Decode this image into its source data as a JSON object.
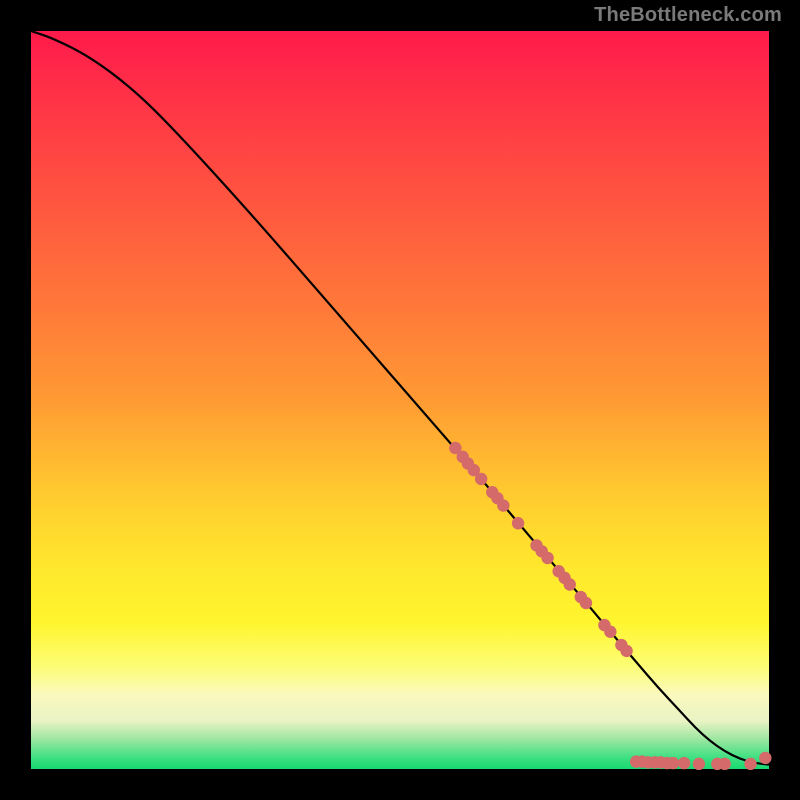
{
  "watermark": "TheBottleneck.com",
  "colors": {
    "bg": "#000000",
    "line": "#000000",
    "dot": "#d46a6a",
    "gradient_stops": [
      {
        "offset": 0.0,
        "color": "#ff1a4b"
      },
      {
        "offset": 0.12,
        "color": "#ff3a45"
      },
      {
        "offset": 0.25,
        "color": "#ff5a3f"
      },
      {
        "offset": 0.38,
        "color": "#ff7a39"
      },
      {
        "offset": 0.5,
        "color": "#ff9a33"
      },
      {
        "offset": 0.62,
        "color": "#ffc82f"
      },
      {
        "offset": 0.72,
        "color": "#ffe62d"
      },
      {
        "offset": 0.8,
        "color": "#fff52d"
      },
      {
        "offset": 0.86,
        "color": "#fdfd74"
      },
      {
        "offset": 0.9,
        "color": "#faf9bf"
      },
      {
        "offset": 0.935,
        "color": "#e9f3c4"
      },
      {
        "offset": 0.96,
        "color": "#9be6a0"
      },
      {
        "offset": 0.985,
        "color": "#3de081"
      },
      {
        "offset": 1.0,
        "color": "#17d96f"
      }
    ]
  },
  "chart_data": {
    "type": "line",
    "title": "",
    "xlabel": "",
    "ylabel": "",
    "xlim": [
      0,
      100
    ],
    "ylim": [
      0,
      100
    ],
    "series": [
      {
        "name": "curve",
        "x": [
          0,
          3,
          8,
          14,
          20,
          30,
          40,
          50,
          60,
          68,
          74,
          78,
          82,
          85,
          88,
          90,
          92,
          94,
          96,
          98,
          100
        ],
        "y": [
          100,
          99,
          96.5,
          92,
          86,
          75,
          63.5,
          52,
          40.5,
          31,
          24,
          19.2,
          14.5,
          11,
          7.8,
          5.6,
          3.8,
          2.4,
          1.4,
          0.8,
          0.6
        ]
      }
    ],
    "dot_groups": [
      {
        "name": "upper-cluster",
        "points": [
          {
            "x": 57.5,
            "y": 43.5
          },
          {
            "x": 58.5,
            "y": 42.3
          },
          {
            "x": 59.2,
            "y": 41.4
          },
          {
            "x": 60.0,
            "y": 40.5
          },
          {
            "x": 61.0,
            "y": 39.3
          },
          {
            "x": 62.5,
            "y": 37.5
          },
          {
            "x": 63.2,
            "y": 36.7
          },
          {
            "x": 64.0,
            "y": 35.7
          },
          {
            "x": 66.0,
            "y": 33.3
          }
        ]
      },
      {
        "name": "mid-cluster",
        "points": [
          {
            "x": 68.5,
            "y": 30.3
          },
          {
            "x": 69.2,
            "y": 29.5
          },
          {
            "x": 70.0,
            "y": 28.6
          },
          {
            "x": 71.5,
            "y": 26.8
          },
          {
            "x": 72.3,
            "y": 25.9
          },
          {
            "x": 73.0,
            "y": 25.0
          },
          {
            "x": 74.5,
            "y": 23.3
          },
          {
            "x": 75.2,
            "y": 22.5
          }
        ]
      },
      {
        "name": "lower-descent",
        "points": [
          {
            "x": 77.7,
            "y": 19.5
          },
          {
            "x": 78.5,
            "y": 18.6
          },
          {
            "x": 80.0,
            "y": 16.8
          },
          {
            "x": 80.7,
            "y": 16.0
          }
        ]
      },
      {
        "name": "bottom-run",
        "points": [
          {
            "x": 82.0,
            "y": 1.0
          },
          {
            "x": 82.8,
            "y": 1.0
          },
          {
            "x": 83.6,
            "y": 0.9
          },
          {
            "x": 84.5,
            "y": 0.9
          },
          {
            "x": 85.3,
            "y": 0.9
          },
          {
            "x": 86.2,
            "y": 0.8
          },
          {
            "x": 87.0,
            "y": 0.8
          },
          {
            "x": 88.5,
            "y": 0.8
          },
          {
            "x": 90.5,
            "y": 0.7
          },
          {
            "x": 93.0,
            "y": 0.7
          },
          {
            "x": 94.0,
            "y": 0.7
          },
          {
            "x": 97.5,
            "y": 0.7
          },
          {
            "x": 99.5,
            "y": 1.5
          }
        ]
      }
    ]
  }
}
